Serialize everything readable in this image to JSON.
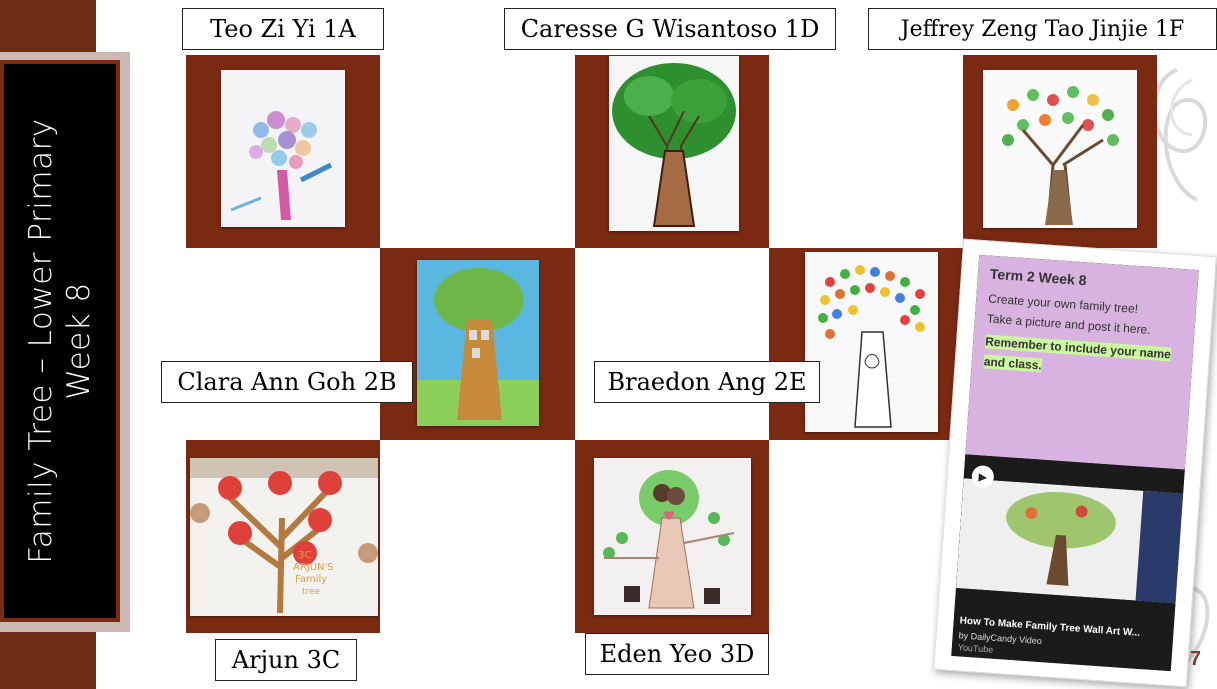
{
  "slide": {
    "title_line1": "Family Tree – Lower Primary",
    "title_line2": "Week 8",
    "slide_number": "7"
  },
  "entries": [
    {
      "label": "Teo Zi Yi 1A"
    },
    {
      "label": "Caresse G Wisantoso 1D"
    },
    {
      "label": "Jeffrey Zeng Tao Jinjie 1F"
    },
    {
      "label": "Clara Ann Goh 2B"
    },
    {
      "label": "Braedon Ang 2E"
    },
    {
      "label": "Arjun  3C"
    },
    {
      "label": "Eden Yeo 3D"
    }
  ],
  "arjun_drawing_text": [
    "3C",
    "ARJUN'S",
    "Family",
    "tree"
  ],
  "padlet": {
    "heading": "Term 2 Week 8",
    "line1": "Create your own family tree!",
    "line2": "Take a picture and post it here.",
    "highlight": "Remember to include your name and class.",
    "video_title": "How To Make Family Tree Wall Art W...",
    "video_channel": "by DailyCandy Video",
    "video_source": "YouTube"
  },
  "colors": {
    "brown": "#7b2a12",
    "title_bg": "#000000",
    "padlet_purple": "#d8b3df",
    "highlight_green": "#caf7a0"
  }
}
